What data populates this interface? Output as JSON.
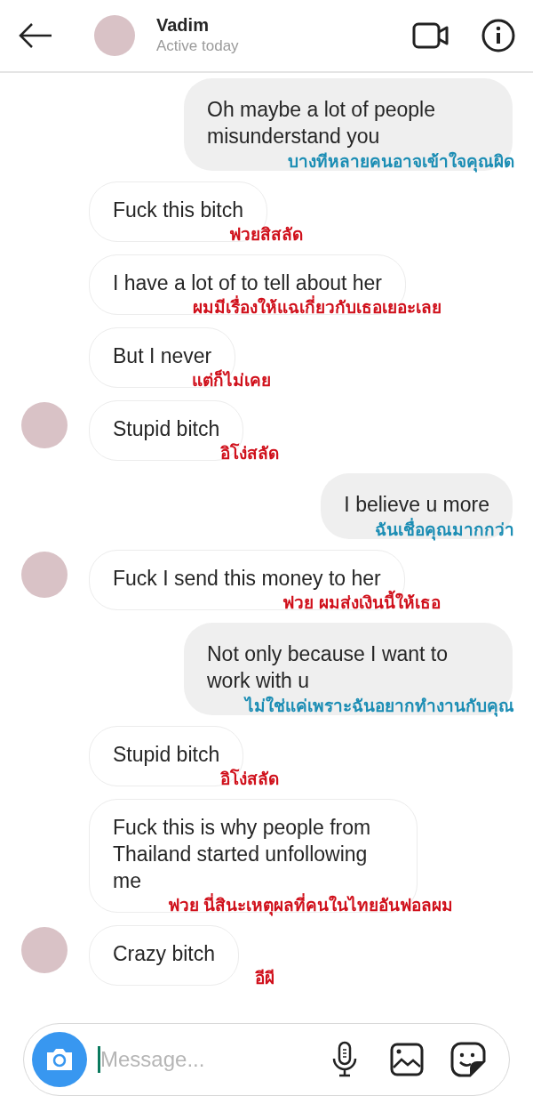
{
  "header": {
    "name": "Vadim",
    "status": "Active today"
  },
  "messages": [
    {
      "kind": "me",
      "text": "Oh maybe a lot of people misunderstand you",
      "translation": "บางทีหลายคนอาจเข้าใจคุณผิด"
    },
    {
      "kind": "them",
      "text": "Fuck this bitch",
      "translation": "ฟวยสิสลัด",
      "avatar": false
    },
    {
      "kind": "them",
      "text": "I have a lot of to tell about her",
      "translation": "ผมมีเรื่องให้แฉเกี่ยวกับเธอเยอะเลย",
      "avatar": false
    },
    {
      "kind": "them",
      "text": "But I never",
      "translation": "แต่ก็ไม่เคย",
      "avatar": false
    },
    {
      "kind": "them",
      "text": "Stupid bitch",
      "translation": "อิโง่สลัด",
      "avatar": true
    },
    {
      "kind": "me",
      "text": "I believe u more",
      "translation": "ฉันเชื่อคุณมากกว่า"
    },
    {
      "kind": "them",
      "text": "Fuck I send this money to her",
      "translation": "ฟวย ผมส่งเงินนี้ให้เธอ",
      "avatar": true
    },
    {
      "kind": "me",
      "text": "Not only because I want to work with u",
      "translation": "ไม่ใช่แค่เพราะฉันอยากทำงานกับคุณ"
    },
    {
      "kind": "them",
      "text": "Stupid bitch",
      "translation": "อิโง่สลัด",
      "avatar": false
    },
    {
      "kind": "them",
      "text": "Fuck this is why people from Thailand started unfollowing me",
      "translation": "ฟวย นี่สินะเหตุผลที่คนในไทยอันฟอลผม",
      "avatar": false
    },
    {
      "kind": "them",
      "text": "Crazy bitch",
      "translation": "อีผี",
      "avatar": true
    }
  ],
  "composer": {
    "placeholder": "Message..."
  }
}
